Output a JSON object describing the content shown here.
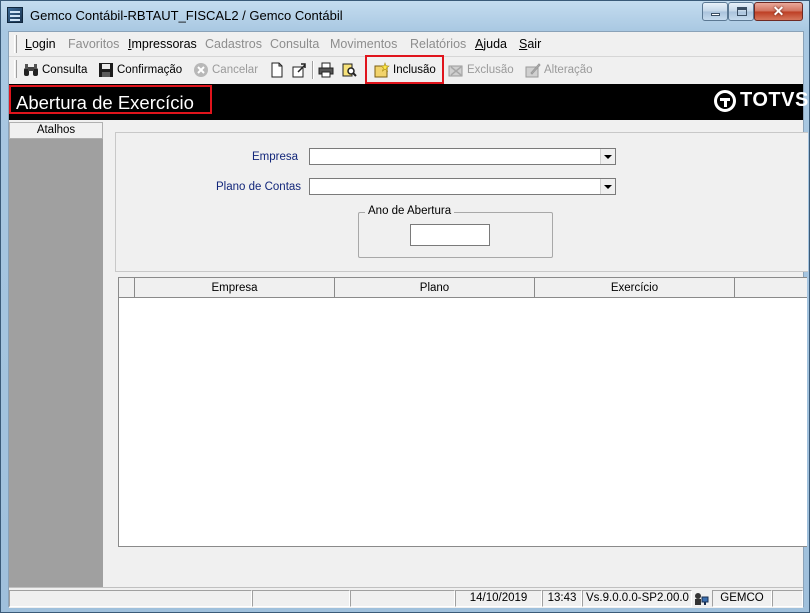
{
  "window": {
    "title": "Gemco Contábil-RBTAUT_FISCAL2 / Gemco Contábil"
  },
  "menu": [
    {
      "label": "Login",
      "u": "L",
      "rest": "ogin",
      "enabled": true
    },
    {
      "label": "Favoritos",
      "enabled": false
    },
    {
      "label": "Impressoras",
      "u": "I",
      "rest": "mpressoras",
      "enabled": true
    },
    {
      "label": "Cadastros",
      "enabled": false
    },
    {
      "label": "Consulta",
      "enabled": false
    },
    {
      "label": "Movimentos",
      "enabled": false
    },
    {
      "label": "Relatórios",
      "enabled": false
    },
    {
      "label": "Ajuda",
      "u": "A",
      "rest": "juda",
      "enabled": true
    },
    {
      "label": "Sair",
      "u": "S",
      "rest": "air",
      "enabled": true
    }
  ],
  "toolbar": {
    "consulta": "Consulta",
    "confirmacao": "Confirmação",
    "cancelar": "Cancelar",
    "inclusao": "Inclusão",
    "exclusao": "Exclusão",
    "alteracao": "Alteração"
  },
  "header": {
    "page_title": "Abertura de Exercício",
    "logo": "TOTVS"
  },
  "sidebar": {
    "title": "Atalhos"
  },
  "form": {
    "empresa_label": "Empresa",
    "empresa_value": "",
    "plano_label": "Plano de Contas",
    "plano_value": "",
    "ano_group": "Ano de Abertura",
    "ano_value": ""
  },
  "grid": {
    "columns": [
      "Empresa",
      "Plano",
      "Exercício"
    ],
    "rows": []
  },
  "status": {
    "date": "14/10/2019",
    "time": "13:43",
    "version": "Vs.9.0.0.0-SP2.00.0",
    "user": "GEMCO"
  },
  "colors": {
    "highlight": "#e0141c",
    "header_bg": "#000000",
    "label_blue": "#12267a"
  }
}
